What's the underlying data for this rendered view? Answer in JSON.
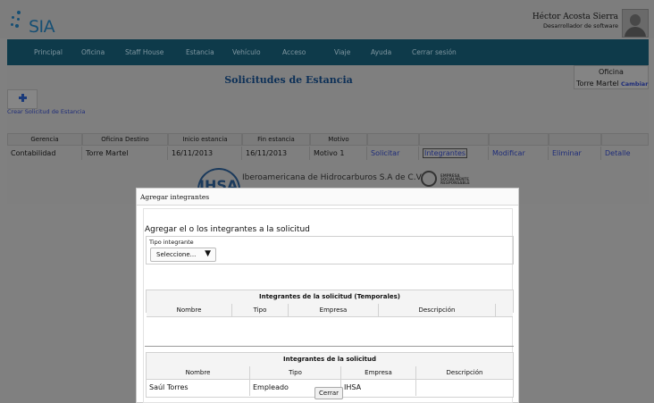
{
  "app": {
    "logo_text": "SIA"
  },
  "user": {
    "name": "Héctor Acosta Sierra",
    "role": "Desarrollador de software"
  },
  "nav": [
    "Principal",
    "Oficina",
    "Staff House",
    "Estancia",
    "Vehículo",
    "Acceso",
    "Viaje",
    "Ayuda",
    "Cerrar sesión"
  ],
  "page": {
    "title": "Solicitudes de Estancia",
    "office_label": "Oficina",
    "office_value": "Torre Martel",
    "office_change": "Cambiar",
    "add_label": "Crear Solicitud de Estancia"
  },
  "grid": {
    "headers": [
      "Gerencia",
      "Oficina Destino",
      "Inicio estancia",
      "Fin estancia",
      "Motivo",
      "",
      "",
      "",
      "",
      ""
    ],
    "row": [
      "Contabilidad",
      "Torre Martel",
      "16/11/2013",
      "16/11/2013",
      "Motivo 1",
      "Solicitar",
      "Integrantes",
      "Modificar",
      "Eliminar",
      "Detalle"
    ]
  },
  "footer": {
    "company": "Iberoamericana de Hidrocarburos S.A de C.V.",
    "logo_text": "IHSA",
    "esr_text": [
      "EMPRESA",
      "SOCIALMENTE",
      "RESPONSABLE"
    ]
  },
  "modal": {
    "title": "Agregar integrantes",
    "heading": "Agregar el o los integrantes a la solicitud",
    "type_label": "Tipo integrante",
    "type_value": "Seleccione...",
    "temp_table": {
      "caption": "Integrantes de la solicitud (Temporales)",
      "headers": [
        "Nombre",
        "Tipo",
        "Empresa",
        "Descripción",
        ""
      ]
    },
    "table": {
      "caption": "Integrantes de la solicitud",
      "headers": [
        "Nombre",
        "Tipo",
        "Empresa",
        "Descripción"
      ],
      "rows": [
        [
          "Saúl Torres",
          "Empleado",
          "IHSA",
          ""
        ]
      ]
    },
    "close_label": "Cerrar"
  },
  "colors": {
    "navbar": "#0e3a4a",
    "title": "#0d3057",
    "link": "#1f2d7a",
    "overlay": "#808080"
  }
}
